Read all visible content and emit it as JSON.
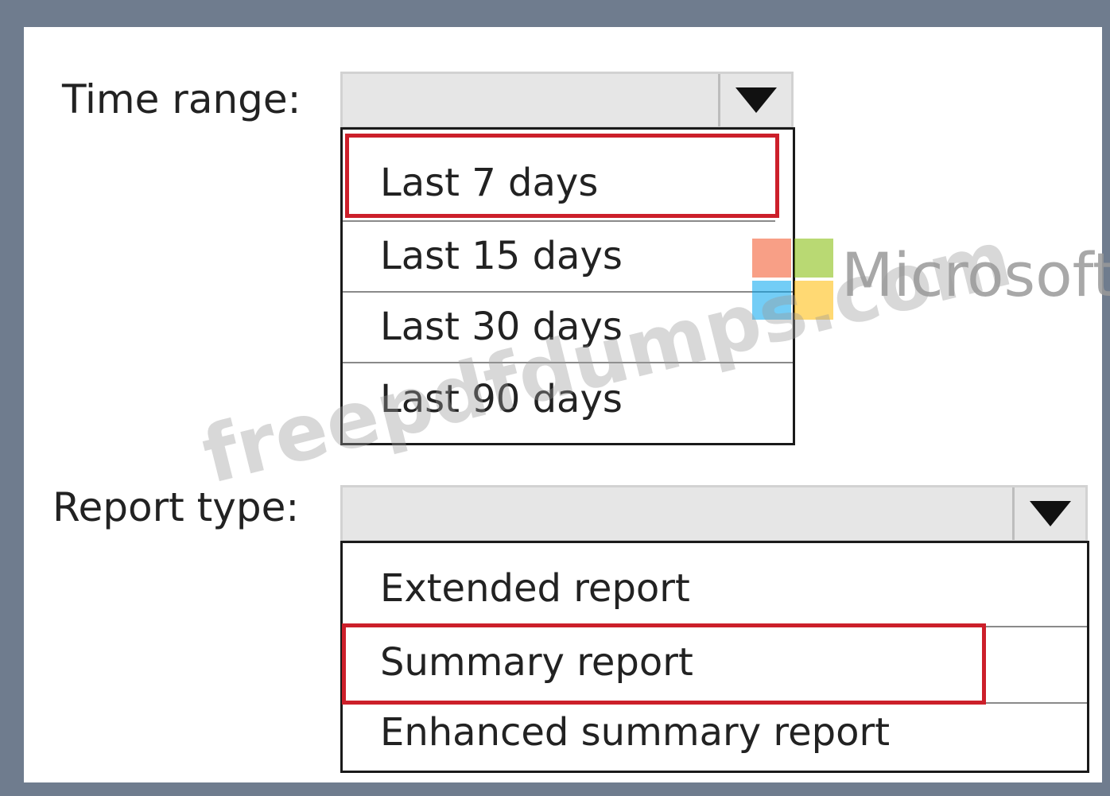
{
  "time_range": {
    "label": "Time range:",
    "selected_value": "",
    "options": [
      "Last 7 days",
      "Last 15 days",
      "Last 30 days",
      "Last 90 days"
    ],
    "highlighted_option": "Last 7 days"
  },
  "report_type": {
    "label": "Report type:",
    "selected_value": "",
    "options": [
      "Extended report",
      "Summary report",
      "Enhanced summary report"
    ],
    "highlighted_option": "Summary report"
  },
  "watermark": {
    "brand": "Microsoft",
    "site": "freepdfdumps.com"
  },
  "colors": {
    "highlight": "#cc1f2a",
    "logo_red": "#f25022",
    "logo_green": "#7fba00",
    "logo_blue": "#00a4ef",
    "logo_yellow": "#ffb900"
  },
  "icons": {
    "dropdown_arrow": "triangle-down-icon"
  }
}
